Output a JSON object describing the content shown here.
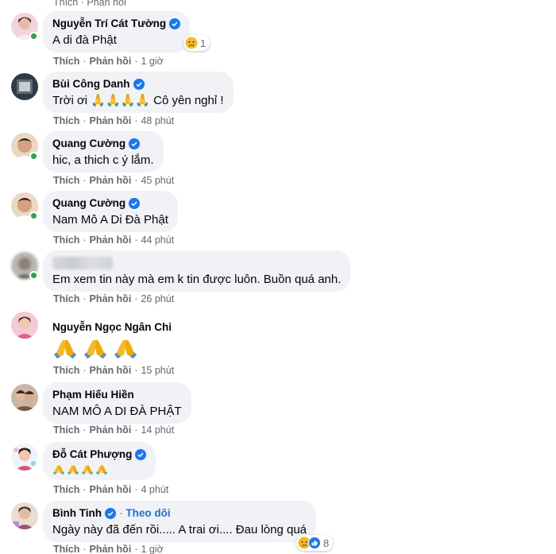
{
  "top_fragment": "Thích · Phản hồi",
  "labels": {
    "like": "Thích",
    "reply": "Phản hồi",
    "follow": "Theo dõi"
  },
  "comments": [
    {
      "name": "Nguyễn Trí Cát Tường",
      "verified": true,
      "text": "A di đà Phật",
      "time": "1 giờ",
      "online": true,
      "reaction": {
        "icons": [
          "sad-emoji"
        ],
        "count": "1"
      }
    },
    {
      "name": "Bùi Công Danh",
      "verified": true,
      "text": "Trời ơi 🙏🙏🙏🙏 Cô yên nghỉ !",
      "time": "48 phút",
      "online": false
    },
    {
      "name": "Quang Cường",
      "verified": true,
      "text": "hic, a thich c ý lắm.",
      "time": "45 phút",
      "online": true
    },
    {
      "name": "Quang Cường",
      "verified": true,
      "text": "Nam Mô A Di Đà Phật",
      "time": "44 phút",
      "online": true
    },
    {
      "name": "",
      "verified": false,
      "text": "Em xem tin này mà em k tin được luôn. Buồn quá anh.",
      "time": "26 phút",
      "online": true,
      "name_blurred": true
    },
    {
      "name": "Nguyễn Ngọc Ngân Chi",
      "verified": false,
      "text": "🙏🙏🙏",
      "time": "15 phút",
      "online": false
    },
    {
      "name": "Phạm Hiếu Hiền",
      "verified": false,
      "text": "NAM MÔ A DI ĐÀ PHẬT",
      "time": "14 phút",
      "online": false
    },
    {
      "name": "Đỗ Cát Phượng",
      "verified": true,
      "text": "🙏🙏🙏🙏",
      "time": "4 phút",
      "online": false
    },
    {
      "name": "Bình Tinh",
      "verified": true,
      "text": "Ngày này đã đến rồi..... A trai ơi.... Đau lòng quá",
      "time": "1 giờ",
      "online": false,
      "follow": true,
      "reaction": {
        "icons": [
          "sad-emoji",
          "like-icon"
        ],
        "count": "8"
      }
    }
  ],
  "colors": {
    "bubble": "#f0f2f5",
    "verified": "#1877f2",
    "follow": "#216fdb",
    "online": "#31a24c",
    "meta": "#65676b"
  }
}
